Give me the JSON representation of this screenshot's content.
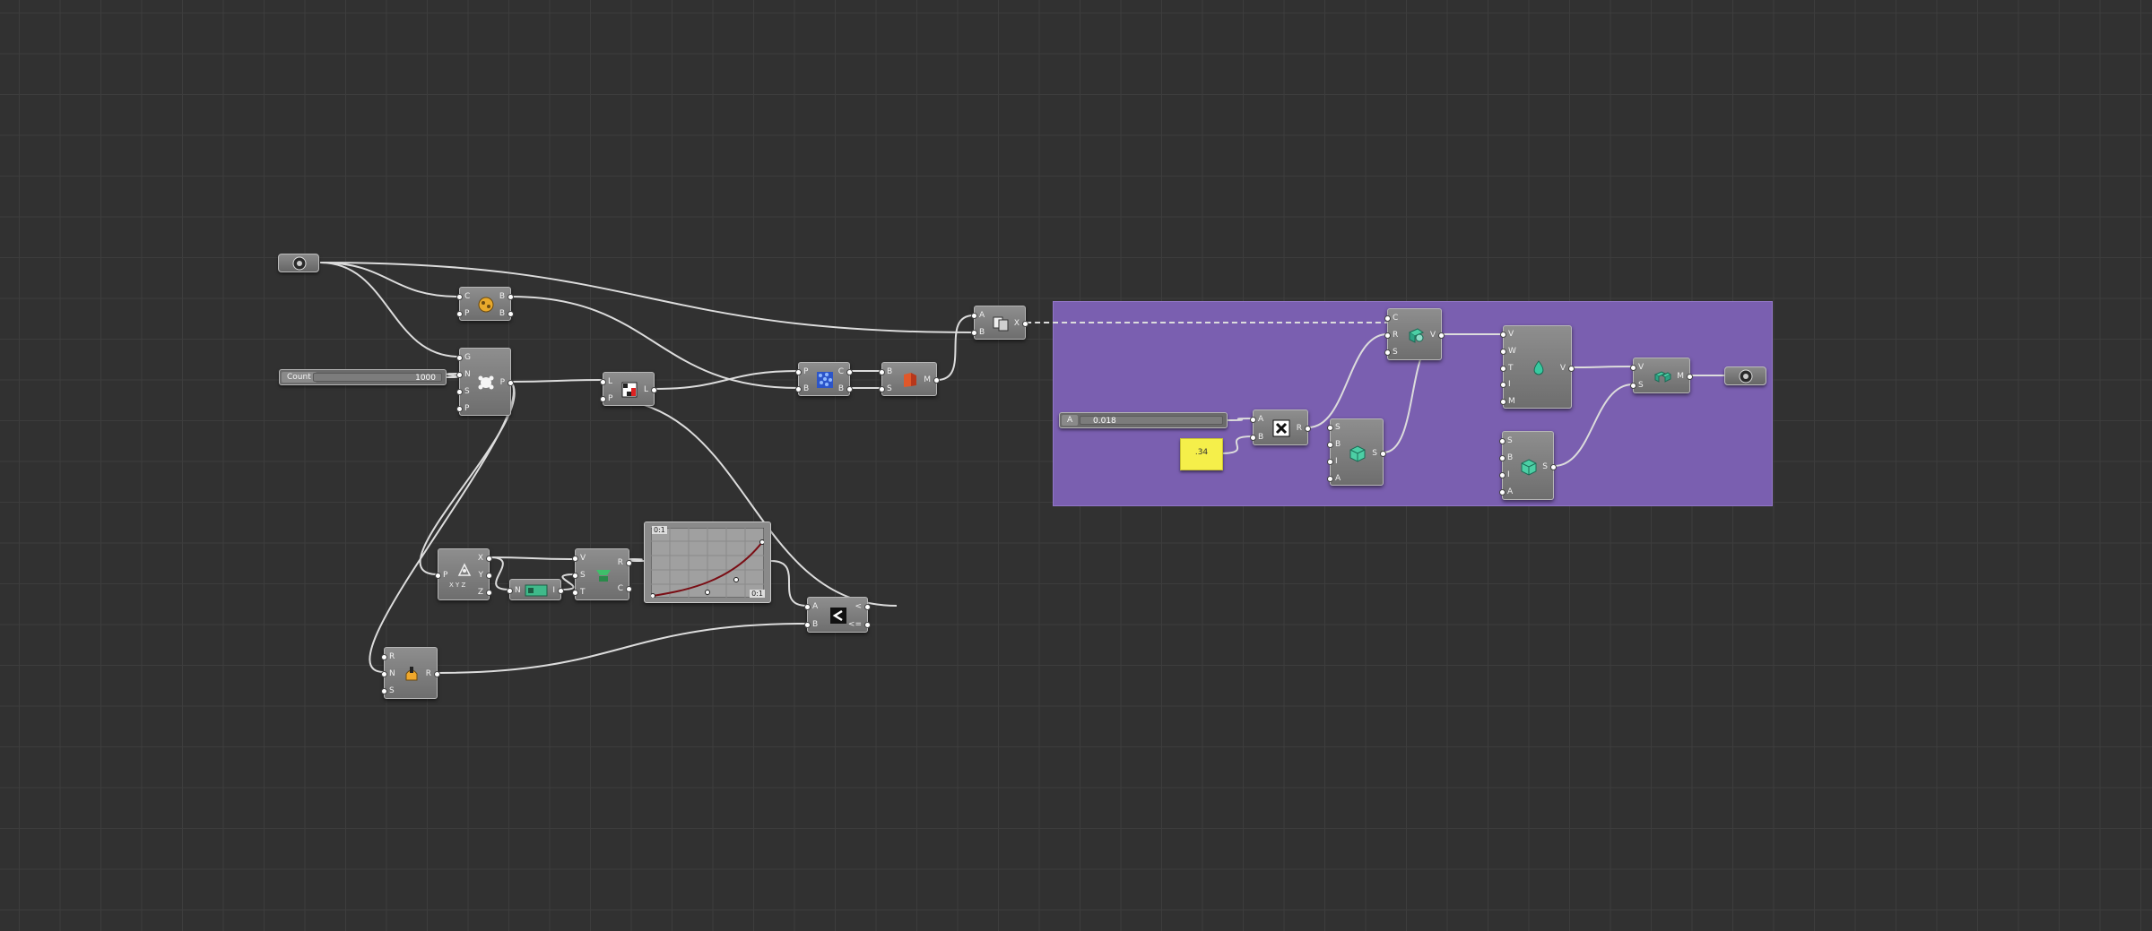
{
  "canvas": {
    "grid": true,
    "background": "#313131",
    "group_color": "#7a5fb0"
  },
  "sliders": {
    "count": {
      "label": "Count",
      "value": "1000"
    },
    "group": {
      "label": "A",
      "value": "0.018"
    }
  },
  "panel": {
    "value": ".34"
  },
  "graph": {
    "top_label": "0:1",
    "bottom_label": "0:1"
  },
  "components": {
    "brep_param": {
      "icon": "brep-param-icon"
    },
    "output_param": {
      "icon": "brep-param-icon"
    },
    "cp": {
      "in": [
        "C",
        "P"
      ],
      "out": [
        "B",
        "B"
      ]
    },
    "populate": {
      "in": [
        "G",
        "N",
        "S",
        "P"
      ],
      "out": [
        "P"
      ]
    },
    "cull": {
      "in": [
        "L",
        "P"
      ],
      "out": [
        "L"
      ]
    },
    "voronoi": {
      "in": [
        "P",
        "B"
      ],
      "out": [
        "C",
        "B"
      ]
    },
    "mesh": {
      "in": [
        "B",
        "S"
      ],
      "out": [
        "M"
      ]
    },
    "ab_x": {
      "in": [
        "A",
        "B"
      ],
      "out": [
        "X"
      ]
    },
    "deconstruct": {
      "in": [
        "P"
      ],
      "out": [
        "X",
        "Y",
        "Z"
      ],
      "caption": "X Y Z"
    },
    "bounds": {
      "in": [
        "N"
      ],
      "out": [
        "I"
      ]
    },
    "remap": {
      "in": [
        "V",
        "S",
        "T"
      ],
      "out": [
        "R",
        "C"
      ]
    },
    "compare": {
      "in": [
        "A",
        "B"
      ],
      "out": [
        "<",
        "<="
      ]
    },
    "random": {
      "in": [
        "R",
        "N",
        "S"
      ],
      "out": [
        "R"
      ]
    },
    "multiply": {
      "in": [
        "A",
        "B"
      ],
      "out": [
        "R"
      ]
    },
    "smooth": {
      "in": [
        "S",
        "B",
        "I",
        "A"
      ],
      "out": [
        "S"
      ]
    },
    "convert": {
      "in": [
        "C",
        "R",
        "S"
      ],
      "out": [
        "V"
      ]
    },
    "weld": {
      "in": [
        "V",
        "W",
        "T",
        "I",
        "M"
      ],
      "out": [
        "V"
      ]
    },
    "smooth2": {
      "in": [
        "S",
        "B",
        "I",
        "A"
      ],
      "out": [
        "S"
      ]
    },
    "join": {
      "in": [
        "V",
        "S"
      ],
      "out": [
        "M"
      ]
    }
  }
}
